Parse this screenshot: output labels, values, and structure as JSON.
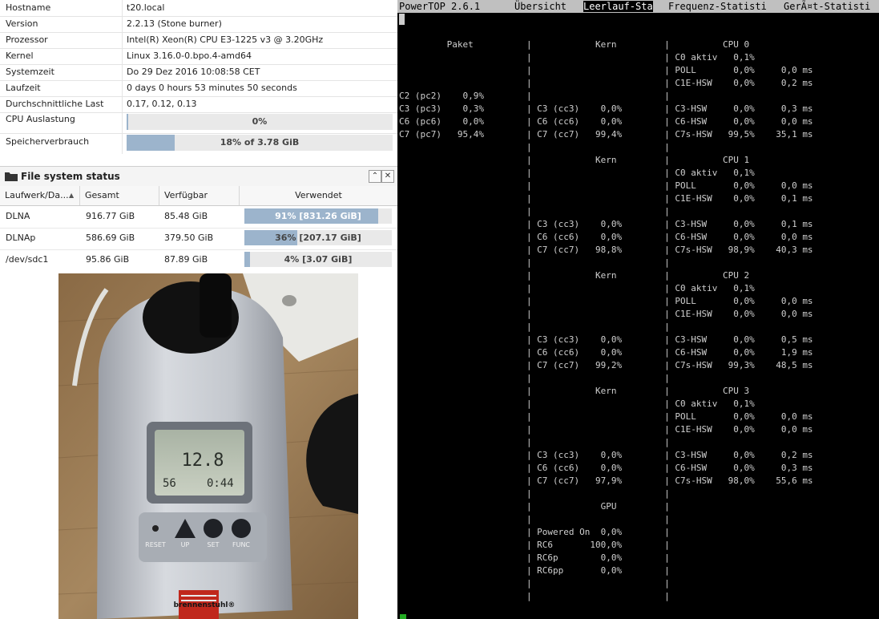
{
  "system_info": {
    "rows": [
      {
        "label": "Hostname",
        "value": "t20.local"
      },
      {
        "label": "Version",
        "value": "2.2.13 (Stone burner)"
      },
      {
        "label": "Prozessor",
        "value": "Intel(R) Xeon(R) CPU E3-1225 v3 @ 3.20GHz"
      },
      {
        "label": "Kernel",
        "value": "Linux 3.16.0-0.bpo.4-amd64"
      },
      {
        "label": "Systemzeit",
        "value": "Do 29 Dez 2016 10:08:58 CET"
      },
      {
        "label": "Laufzeit",
        "value": "0 days 0 hours 53 minutes 50 seconds"
      },
      {
        "label": "Durchschnittliche Last",
        "value": "0.17, 0.12, 0.13"
      }
    ],
    "cpu": {
      "label": "CPU Auslastung",
      "text": "0%",
      "fraction": 0.0
    },
    "memory": {
      "label": "Speicherverbrauch",
      "text": "18% of 3.78 GiB",
      "fraction": 0.18
    }
  },
  "filesystem": {
    "title": "File system status",
    "columns": [
      "Laufwerk/Da...",
      "Gesamt",
      "Verfügbar",
      "Verwendet"
    ],
    "rows": [
      {
        "drive": "DLNA",
        "total": "916.77 GiB",
        "available": "85.48 GiB",
        "used_text": "91% [831.26 GiB]",
        "fraction": 0.91
      },
      {
        "drive": "DLNAp",
        "total": "586.69 GiB",
        "available": "379.50 GiB",
        "used_text": "36% [207.17 GiB]",
        "fraction": 0.36
      },
      {
        "drive": "/dev/sdc1",
        "total": "95.86 GiB",
        "available": "87.89 GiB",
        "used_text": "4% [3.07 GiB]",
        "fraction": 0.04
      }
    ]
  },
  "photo": {
    "display_value": "12.8",
    "display_left": "56",
    "display_right": "0:44",
    "buttons": [
      "RESET",
      "UP",
      "SET",
      "FUNC"
    ],
    "brand": "brennenstuhl®"
  },
  "terminal": {
    "tabs": [
      "PowerTOP 2.6.1",
      "Übersicht",
      "Leerlauf-Sta",
      "Frequenz-Statisti",
      "GerÃ¤t-Statisti"
    ],
    "lines": [
      "         Paket          |            Kern         |          CPU 0",
      "                        |                         | C0 aktiv   0,1%",
      "                        |                         | POLL       0,0%     0,0 ms",
      "                        |                         | C1E-HSW    0,0%     0,2 ms",
      "C2 (pc2)    0,9%        |                         |",
      "C3 (pc3)    0,3%        | C3 (cc3)    0,0%        | C3-HSW     0,0%     0,3 ms",
      "C6 (pc6)    0,0%        | C6 (cc6)    0,0%        | C6-HSW     0,0%     0,0 ms",
      "C7 (pc7)   95,4%        | C7 (cc7)   99,4%        | C7s-HSW   99,5%    35,1 ms",
      "                        |                         |",
      "                        |            Kern         |          CPU 1",
      "                        |                         | C0 aktiv   0,1%",
      "                        |                         | POLL       0,0%     0,0 ms",
      "                        |                         | C1E-HSW    0,0%     0,1 ms",
      "                        |                         |",
      "                        | C3 (cc3)    0,0%        | C3-HSW     0,0%     0,1 ms",
      "                        | C6 (cc6)    0,0%        | C6-HSW     0,0%     0,0 ms",
      "                        | C7 (cc7)   98,8%        | C7s-HSW   98,9%    40,3 ms",
      "                        |                         |",
      "                        |            Kern         |          CPU 2",
      "                        |                         | C0 aktiv   0,1%",
      "                        |                         | POLL       0,0%     0,0 ms",
      "                        |                         | C1E-HSW    0,0%     0,0 ms",
      "                        |                         |",
      "                        | C3 (cc3)    0,0%        | C3-HSW     0,0%     0,5 ms",
      "                        | C6 (cc6)    0,0%        | C6-HSW     0,0%     1,9 ms",
      "                        | C7 (cc7)   99,2%        | C7s-HSW   99,3%    48,5 ms",
      "                        |                         |",
      "                        |            Kern         |          CPU 3",
      "                        |                         | C0 aktiv   0,1%",
      "                        |                         | POLL       0,0%     0,0 ms",
      "                        |                         | C1E-HSW    0,0%     0,0 ms",
      "                        |                         |",
      "                        | C3 (cc3)    0,0%        | C3-HSW     0,0%     0,2 ms",
      "                        | C6 (cc6)    0,0%        | C6-HSW     0,0%     0,3 ms",
      "                        | C7 (cc7)   97,9%        | C7s-HSW   98,0%    55,6 ms",
      "                        |                         |",
      "                        |             GPU         |",
      "                        |                         |",
      "                        | Powered On  0,0%        |",
      "                        | RC6       100,0%        |",
      "                        | RC6p        0,0%        |",
      "                        | RC6pp       0,0%        |",
      "                        |                         |",
      "                        |                         |"
    ]
  },
  "colors": {
    "bar_fill": "#9cb4cc",
    "bar_track": "#e9e9e9",
    "terminal_bg": "#000000",
    "terminal_text": "#cfcfcf",
    "tab_bar": "#c0c0c0"
  }
}
